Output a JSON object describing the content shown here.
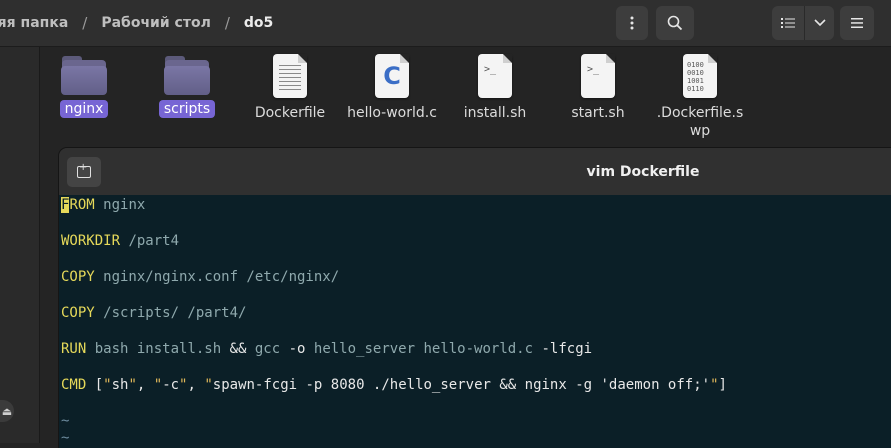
{
  "header": {
    "breadcrumbs": [
      "няя папка",
      "Рабочий стол",
      "do5"
    ],
    "separator": "/",
    "menu_icon": "kebab-menu-icon",
    "search_icon": "search-icon",
    "list_view_icon": "list-view-icon",
    "view_options_icon": "chevron-down-icon",
    "hamburger_icon": "hamburger-menu-icon"
  },
  "files": [
    {
      "name": "nginx",
      "icon": "folder-icon",
      "selected": true
    },
    {
      "name": "scripts",
      "icon": "folder-icon",
      "selected": true
    },
    {
      "name": "Dockerfile",
      "icon": "text-file-icon"
    },
    {
      "name": "hello-world.c",
      "icon": "c-source-icon",
      "glyph": "C"
    },
    {
      "name": "install.sh",
      "icon": "shell-script-icon",
      "glyph": ">_"
    },
    {
      "name": "start.sh",
      "icon": "shell-script-icon",
      "glyph": ">_"
    },
    {
      "name": ".Dockerfile.swp",
      "icon": "binary-file-icon",
      "glyph": "0100\n0010\n1001\n0110"
    }
  ],
  "terminal": {
    "title": "vim Dockerfile",
    "new_tab_icon": "new-tab-icon",
    "lines": [
      {
        "kw": "FROM",
        "rest": [
          {
            "t": " nginx",
            "c": "arg"
          }
        ]
      },
      {
        "kw": "WORKDIR",
        "rest": [
          {
            "t": " /part4",
            "c": "arg"
          }
        ]
      },
      {
        "kw": "COPY",
        "rest": [
          {
            "t": " nginx/nginx.conf /etc/nginx/",
            "c": "arg"
          }
        ]
      },
      {
        "kw": "COPY",
        "rest": [
          {
            "t": " /scripts/ /part4/",
            "c": "arg"
          }
        ]
      },
      {
        "kw": "RUN",
        "rest": [
          {
            "t": " bash install.sh ",
            "c": "arg"
          },
          {
            "t": "&&",
            "c": "op"
          },
          {
            "t": " gcc ",
            "c": "arg"
          },
          {
            "t": "-o",
            "c": "op"
          },
          {
            "t": " hello_server hello-world.c ",
            "c": "arg"
          },
          {
            "t": "-lfcgi",
            "c": "op"
          }
        ]
      },
      {
        "kw": "CMD",
        "rest": [
          {
            "t": " [",
            "c": "op"
          },
          {
            "t": "\"",
            "c": "q"
          },
          {
            "t": "sh",
            "c": "str"
          },
          {
            "t": "\"",
            "c": "q"
          },
          {
            "t": ", ",
            "c": "op"
          },
          {
            "t": "\"",
            "c": "q"
          },
          {
            "t": "-c",
            "c": "str"
          },
          {
            "t": "\"",
            "c": "q"
          },
          {
            "t": ", ",
            "c": "op"
          },
          {
            "t": "\"",
            "c": "q"
          },
          {
            "t": "spawn-fcgi -p 8080 ./hello_server && nginx -g 'daemon off;'",
            "c": "str"
          },
          {
            "t": "\"",
            "c": "q"
          },
          {
            "t": "]",
            "c": "op"
          }
        ]
      }
    ],
    "empty_line_marker": "~"
  },
  "colors": {
    "terminal_bg": "#0b1f27",
    "keyword": "#e6d95a",
    "selection": "#7765d4"
  }
}
